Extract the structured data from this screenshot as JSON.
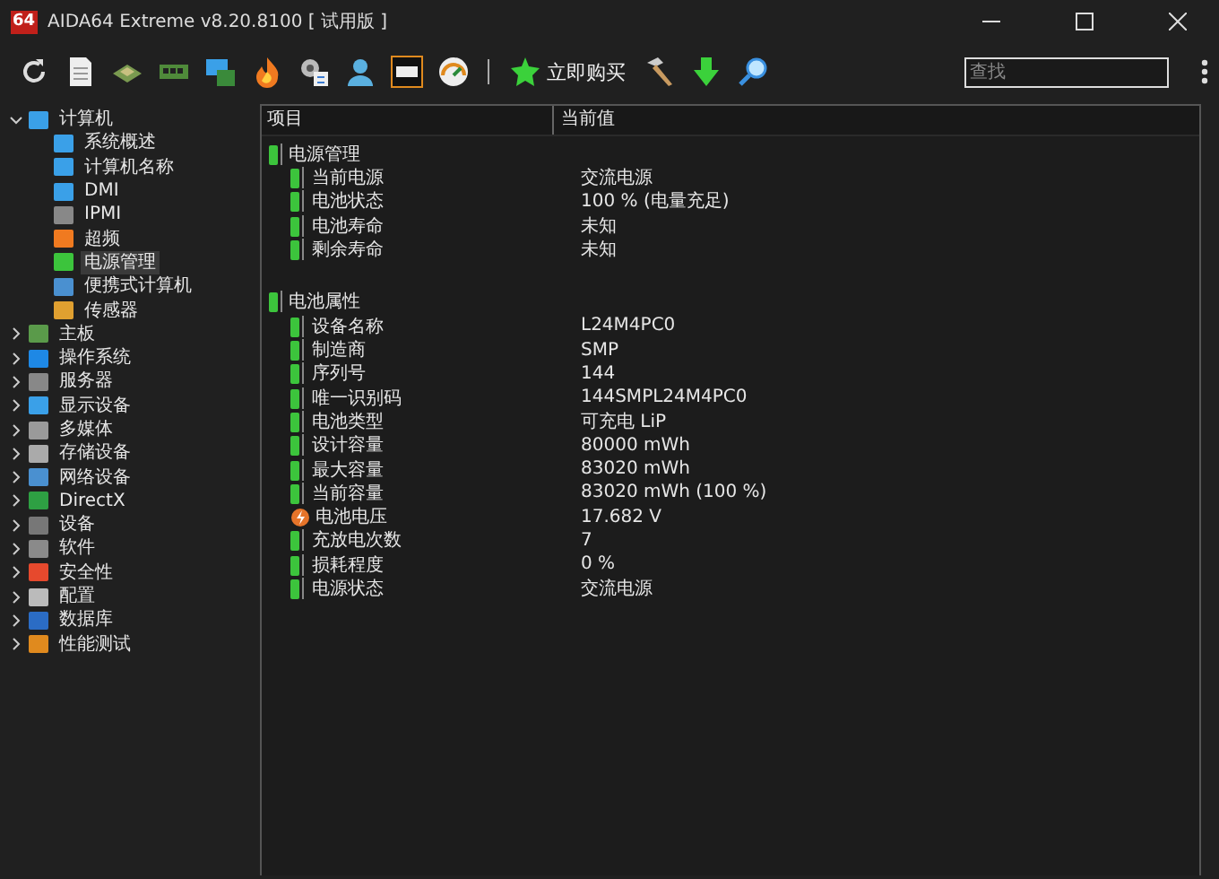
{
  "window": {
    "logo": "64",
    "title": "AIDA64 Extreme v8.20.8100  [ 试用版 ]"
  },
  "toolbar": {
    "buy_label": "立即购买",
    "search": {
      "placeholder": "查找"
    }
  },
  "tree": [
    {
      "label": "计算机",
      "expanded": true,
      "selected": false,
      "children": [
        {
          "label": "系统概述",
          "selected": false
        },
        {
          "label": "计算机名称",
          "selected": false
        },
        {
          "label": "DMI",
          "selected": false
        },
        {
          "label": "IPMI",
          "selected": false
        },
        {
          "label": "超频",
          "selected": false
        },
        {
          "label": "电源管理",
          "selected": true
        },
        {
          "label": "便携式计算机",
          "selected": false
        },
        {
          "label": "传感器",
          "selected": false
        }
      ]
    },
    {
      "label": "主板",
      "expanded": false,
      "selected": false
    },
    {
      "label": "操作系统",
      "expanded": false,
      "selected": false
    },
    {
      "label": "服务器",
      "expanded": false,
      "selected": false
    },
    {
      "label": "显示设备",
      "expanded": false,
      "selected": false
    },
    {
      "label": "多媒体",
      "expanded": false,
      "selected": false
    },
    {
      "label": "存储设备",
      "expanded": false,
      "selected": false
    },
    {
      "label": "网络设备",
      "expanded": false,
      "selected": false
    },
    {
      "label": "DirectX",
      "expanded": false,
      "selected": false
    },
    {
      "label": "设备",
      "expanded": false,
      "selected": false
    },
    {
      "label": "软件",
      "expanded": false,
      "selected": false
    },
    {
      "label": "安全性",
      "expanded": false,
      "selected": false
    },
    {
      "label": "配置",
      "expanded": false,
      "selected": false
    },
    {
      "label": "数据库",
      "expanded": false,
      "selected": false
    },
    {
      "label": "性能测试",
      "expanded": false,
      "selected": false
    }
  ],
  "table": {
    "columns": [
      "项目",
      "当前值"
    ],
    "sections": [
      {
        "title": "电源管理",
        "rows": [
          {
            "kind": "battery",
            "item": "当前电源",
            "value": "交流电源"
          },
          {
            "kind": "battery",
            "item": "电池状态",
            "value": "100 % (电量充足)"
          },
          {
            "kind": "battery",
            "item": "电池寿命",
            "value": "未知"
          },
          {
            "kind": "battery",
            "item": "剩余寿命",
            "value": "未知"
          }
        ]
      },
      {
        "title": "电池属性",
        "rows": [
          {
            "kind": "battery",
            "item": "设备名称",
            "value": "L24M4PC0"
          },
          {
            "kind": "battery",
            "item": "制造商",
            "value": "SMP"
          },
          {
            "kind": "battery",
            "item": "序列号",
            "value": "144"
          },
          {
            "kind": "battery",
            "item": "唯一识别码",
            "value": "144SMPL24M4PC0"
          },
          {
            "kind": "battery",
            "item": "电池类型",
            "value": "可充电 LiP"
          },
          {
            "kind": "battery",
            "item": "设计容量",
            "value": "80000 mWh"
          },
          {
            "kind": "battery",
            "item": "最大容量",
            "value": "83020 mWh"
          },
          {
            "kind": "battery",
            "item": "当前容量",
            "value": "83020 mWh  (100 %)"
          },
          {
            "kind": "voltage",
            "item": "电池电压",
            "value": "17.682 V"
          },
          {
            "kind": "battery",
            "item": "充放电次数",
            "value": "7"
          },
          {
            "kind": "battery",
            "item": "损耗程度",
            "value": "0 %"
          },
          {
            "kind": "battery",
            "item": "电源状态",
            "value": "交流电源"
          }
        ]
      }
    ]
  }
}
